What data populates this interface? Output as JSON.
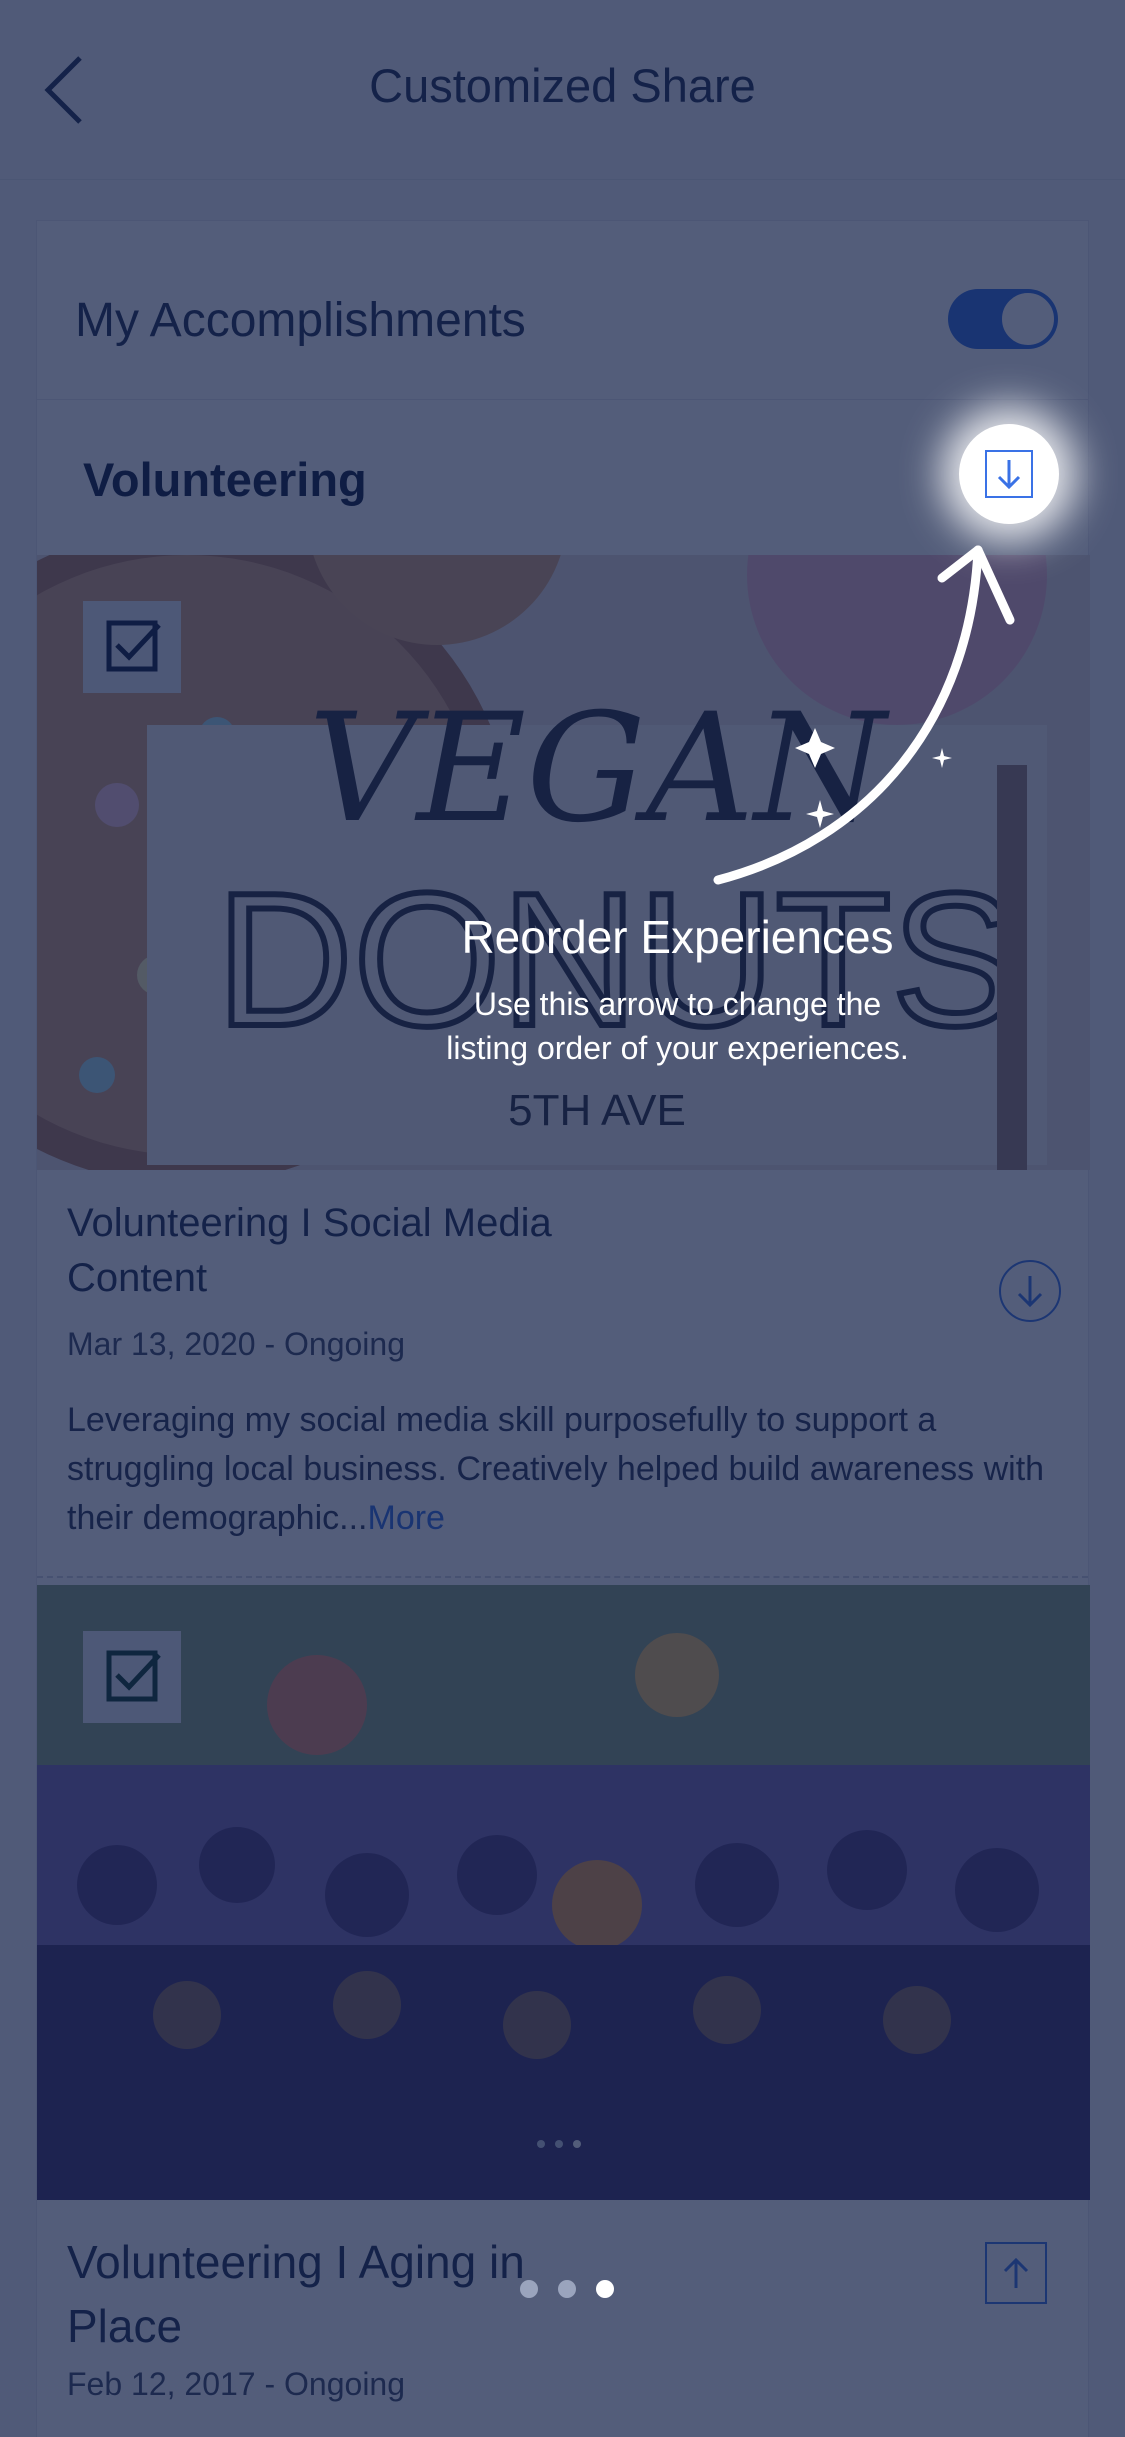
{
  "header": {
    "title": "Customized Share",
    "back_icon": "chevron-left-icon"
  },
  "accomplishments": {
    "label": "My Accomplishments",
    "toggle_on": true
  },
  "section": {
    "title": "Volunteering"
  },
  "coachmark": {
    "title": "Reorder Experiences",
    "text": "Use this arrow to change the listing order of your experiences."
  },
  "experiences": [
    {
      "image_text": [
        "VEGAN",
        "DONUTS",
        "5TH AVE"
      ],
      "title": "Volunteering I Social Media Content",
      "date": "Mar 13, 2020 - Ongoing",
      "description": "Leveraging my social media skill purposefully to support a struggling local business. Creatively helped build awareness with their demographic...",
      "more_label": "More",
      "checked": true,
      "move_icon": "arrow-down-circle-icon"
    },
    {
      "title": "Volunteering I Aging in Place",
      "date": "Feb 12, 2017 - Ongoing",
      "checked": true,
      "move_icon": "arrow-up-square-icon"
    }
  ],
  "colors": {
    "accent": "#2f6be3",
    "overlay": "#101e46",
    "text": "#1d2b4f"
  }
}
